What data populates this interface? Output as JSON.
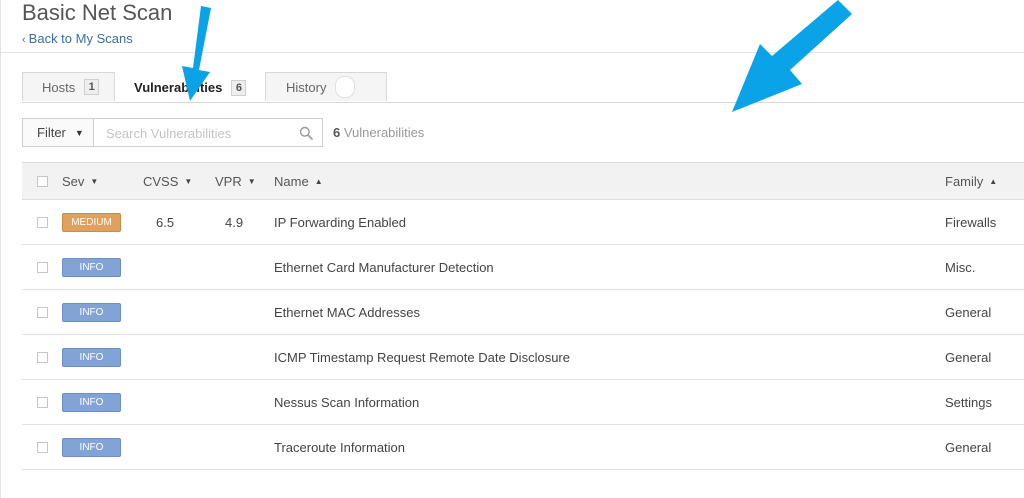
{
  "header": {
    "title": "Basic Net Scan",
    "back_link": "Back to My Scans"
  },
  "tabs": [
    {
      "label": "Hosts",
      "count": "1"
    },
    {
      "label": "Vulnerabilities",
      "count": "6"
    },
    {
      "label": "History",
      "count": ""
    }
  ],
  "filter": {
    "button_label": "Filter",
    "search_placeholder": "Search Vulnerabilities",
    "result_count": "6",
    "result_label": "Vulnerabilities"
  },
  "table": {
    "columns": {
      "sev": "Sev",
      "cvss": "CVSS",
      "vpr": "VPR",
      "name": "Name",
      "family": "Family"
    },
    "rows": [
      {
        "severity": "MEDIUM",
        "cvss": "6.5",
        "vpr": "4.9",
        "name": "IP Forwarding Enabled",
        "family": "Firewalls"
      },
      {
        "severity": "INFO",
        "cvss": "",
        "vpr": "",
        "name": "Ethernet Card Manufacturer Detection",
        "family": "Misc."
      },
      {
        "severity": "INFO",
        "cvss": "",
        "vpr": "",
        "name": "Ethernet MAC Addresses",
        "family": "General"
      },
      {
        "severity": "INFO",
        "cvss": "",
        "vpr": "",
        "name": "ICMP Timestamp Request Remote Date Disclosure",
        "family": "General"
      },
      {
        "severity": "INFO",
        "cvss": "",
        "vpr": "",
        "name": "Nessus Scan Information",
        "family": "Settings"
      },
      {
        "severity": "INFO",
        "cvss": "",
        "vpr": "",
        "name": "Traceroute Information",
        "family": "General"
      }
    ]
  },
  "colors": {
    "medium": "#e0a15f",
    "info": "#82a3d6",
    "annotation_arrow": "#0aa3e8"
  },
  "icons": {
    "search": "search-icon",
    "back": "chevron-left-icon",
    "filter_caret": "caret-down-icon"
  }
}
